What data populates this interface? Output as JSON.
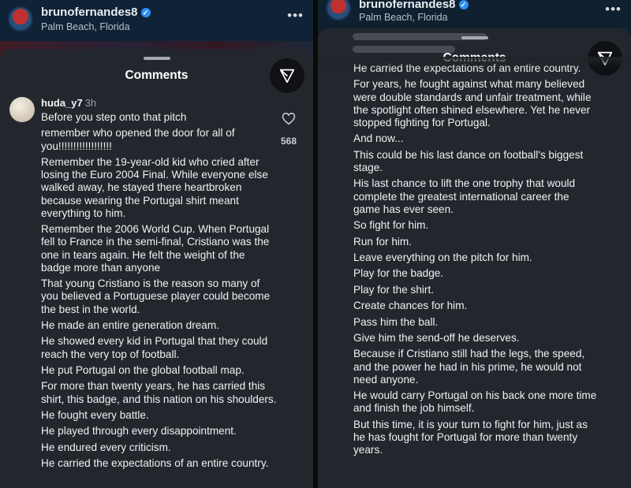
{
  "post": {
    "username": "brunofernandes8",
    "location": "Palm Beach, Florida",
    "more_icon": "ellipsis-icon"
  },
  "comments_sheet": {
    "title": "Comments",
    "filter_icon": "paper-plane-filter-icon"
  },
  "comment": {
    "username": "huda_y7",
    "time": "3h",
    "like_count": "568",
    "like_icon": "heart-icon"
  },
  "left_paragraphs": [
    "Before you step onto that pitch",
    "remember who opened the door for all of you!!!!!!!!!!!!!!!!!!",
    "Remember the 19-year-old kid who cried after losing the Euro 2004 Final. While everyone else walked away, he stayed there heartbroken because wearing the Portugal shirt meant everything to him.",
    "Remember the 2006 World Cup. When Portugal fell to France in the semi-final, Cristiano was the one in tears again. He felt the weight of the badge more than anyone",
    "That young Cristiano is the reason so many of you believed a Portuguese player could become the best in the world.",
    "He made an entire generation dream.",
    "He showed every kid in Portugal that they could reach the very top of football.",
    "He put Portugal on the global football map.",
    "For more than twenty years, he has carried this shirt, this badge, and this nation on his shoulders.",
    "He fought every battle.",
    "He played through every disappointment.",
    "He endured every criticism.",
    "He carried the expectations of an entire country."
  ],
  "right_paragraphs": [
    "He carried the expectations of an entire country.",
    "For years, he fought against what many believed were double standards and unfair treatment, while the spotlight often shined elsewhere. Yet he never stopped fighting for Portugal.",
    "And now...",
    "This could be his last dance on football's biggest stage.",
    "His last chance to lift the one trophy that would complete the greatest international career the game has ever seen.",
    "So fight for him.",
    "Run for him.",
    "Leave everything on the pitch for him.",
    "Play for the badge.",
    "Play for the shirt.",
    "Create chances for him.",
    "Pass him the ball.",
    "Give him the send-off he deserves.",
    "Because if Cristiano still had the legs, the speed, and the power he had in his prime, he would not need anyone.",
    "He would carry Portugal on his back one more time and finish the job himself.",
    "But this time, it is your turn to fight for him, just as he has fought for Portugal for more than twenty years."
  ],
  "colors": {
    "sheet_bg": "#23272d",
    "verified": "#2f8ff5",
    "text": "#f0f0f0",
    "muted": "#9aa2aa"
  }
}
